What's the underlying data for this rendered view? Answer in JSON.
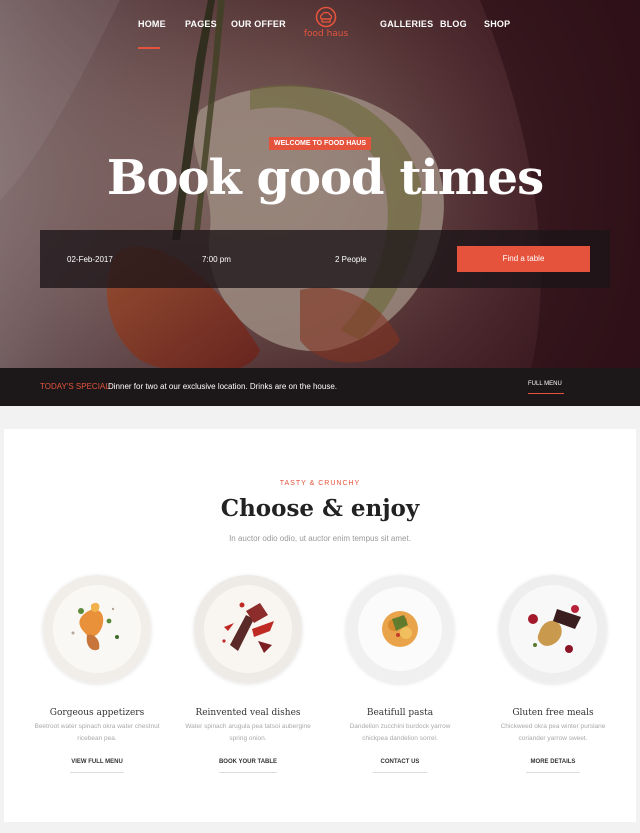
{
  "nav": {
    "items": [
      {
        "label": "HOME",
        "active": true
      },
      {
        "label": "PAGES"
      },
      {
        "label": "OUR OFFER"
      },
      {
        "label": "GALLERIES"
      },
      {
        "label": "BLOG"
      },
      {
        "label": "SHOP"
      }
    ],
    "logo_text": "food haus",
    "logo_icon": "chef-hat-icon"
  },
  "hero": {
    "badge": "WELCOME TO FOOD HAUS",
    "title": "Book good times",
    "booking": {
      "date": "02-Feb-2017",
      "time": "7:00 pm",
      "people": "2 People",
      "button": "Find a table"
    }
  },
  "special_bar": {
    "label": "TODAY'S SPECIAL:",
    "text": "Dinner for two at our exclusive location. Drinks are on the house.",
    "link": "FULL MENU"
  },
  "section": {
    "kicker": "TASTY & CRUNCHY",
    "title": "Choose & enjoy",
    "subtitle": "In auctor odio odio, ut auctor enim tempus sit amet."
  },
  "cards": [
    {
      "title": "Gorgeous appetizers",
      "desc": "Beetroot water spinach okra water chestnut ricebean pea.",
      "link": "VIEW FULL MENU"
    },
    {
      "title": "Reinvented veal dishes",
      "desc": "Water spinach arugula pea tatsoi aubergine spring onion.",
      "link": "BOOK YOUR TABLE"
    },
    {
      "title": "Beatifull pasta",
      "desc": "Dandelion zucchini burdock yarrow chickpea dandelion sorrel.",
      "link": "CONTACT US"
    },
    {
      "title": "Gluten free meals",
      "desc": "Chickweed okra pea winter purslane coriander yarrow sweet.",
      "link": "MORE DETAILS"
    }
  ],
  "colors": {
    "accent": "#e5533d",
    "dark_bar": "#1c1719"
  }
}
